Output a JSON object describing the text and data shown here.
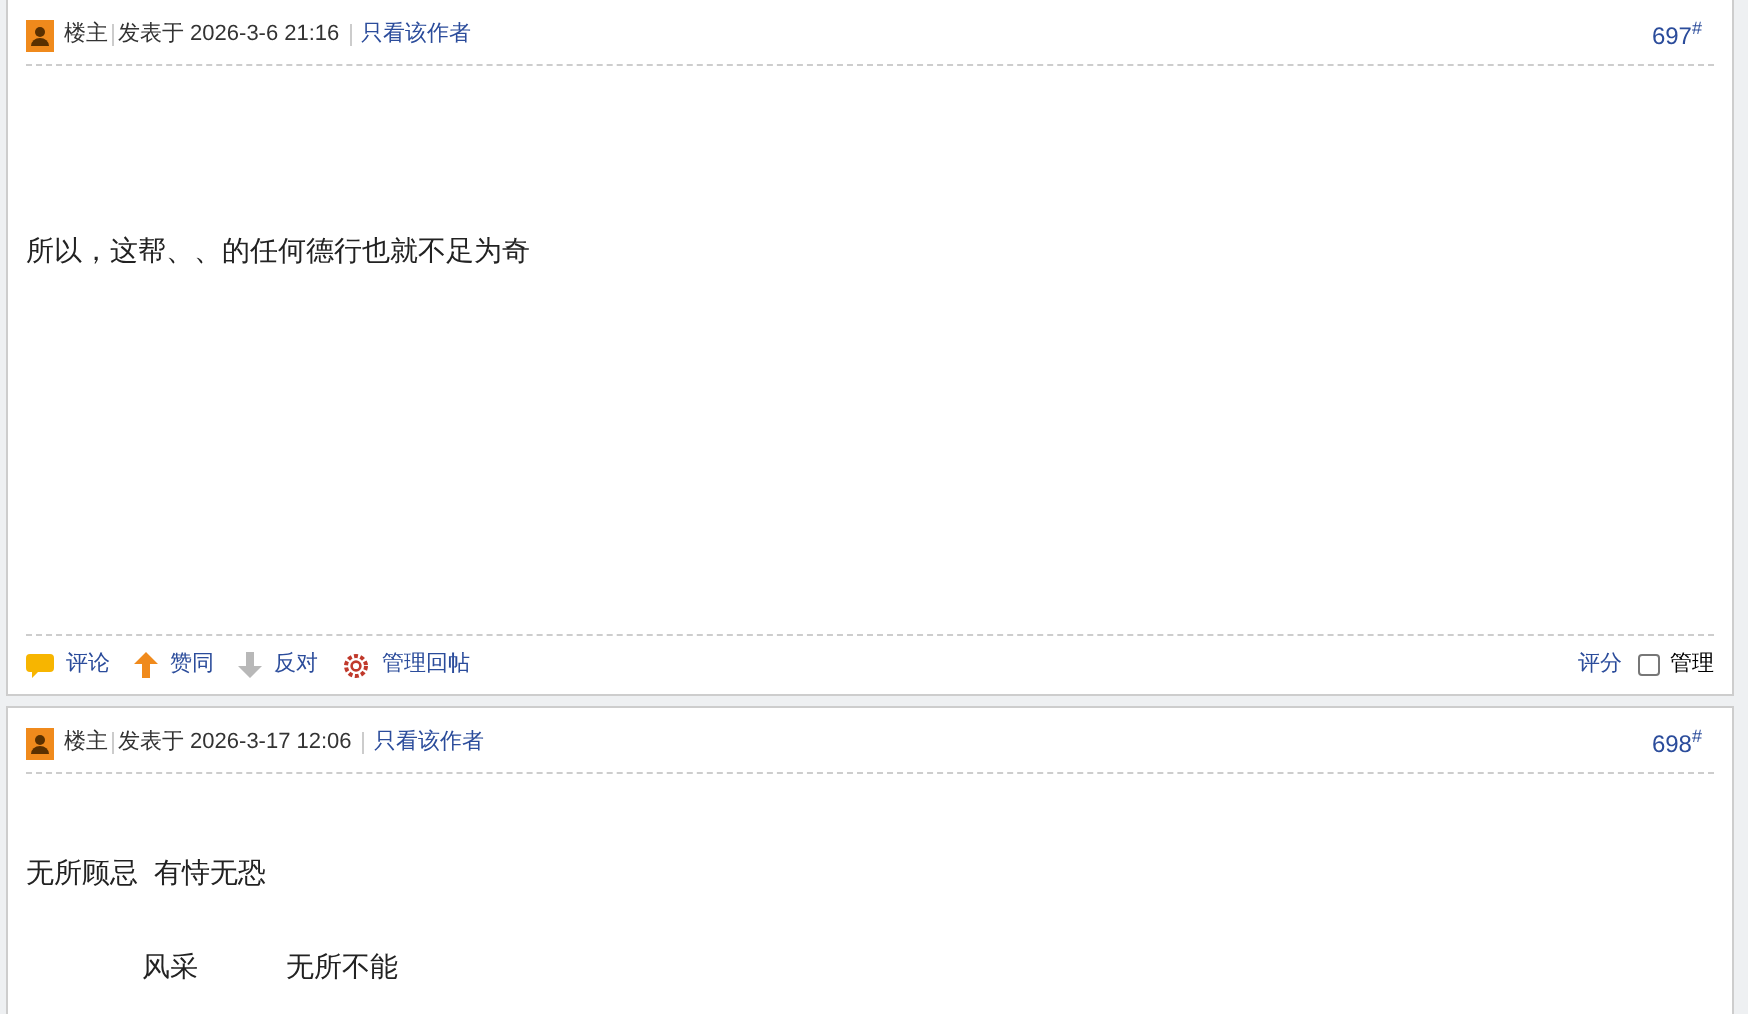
{
  "posts": [
    {
      "author": "楼主",
      "posted": "发表于 2026-3-6 21:16",
      "author_only": "只看该作者",
      "floor": "697$^{#}$",
      "lines": [
        {
          "text": "所以，这帮、、的任何德行也就不足为奇"
        }
      ],
      "footer": {
        "actions": [
          {
            "kind": "comment",
            "label": "评论"
          },
          {
            "kind": "support",
            "label": "赞同"
          },
          {
            "kind": "oppose",
            "label": "反对"
          },
          {
            "kind": "manage",
            "label": "管理回帖"
          }
        ],
        "rate": "评分",
        "manage": {
          "label": "管理",
          "checked": false
        }
      }
    },
    {
      "author": "楼主",
      "posted": "发表于 2026-3-17 12:06",
      "author_only": "只看该作者",
      "floor": "698$^{#}$",
      "lines": [
        {
          "text": "无所顾忌  有恃无恐"
        },
        {
          "kind": "columns",
          "parts": [
            "风采",
            "无所不能"
          ]
        }
      ]
    }
  ]
}
